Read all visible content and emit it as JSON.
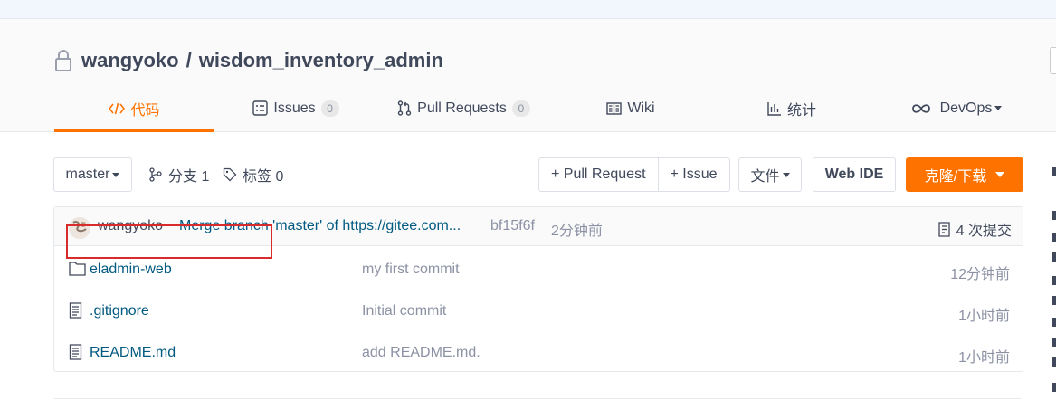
{
  "repo": {
    "owner": "wangyoko",
    "separator": "/",
    "name": "wisdom_inventory_admin"
  },
  "tabs": [
    {
      "label": "代码",
      "icon": "code-icon"
    },
    {
      "label": "Issues",
      "icon": "issues-icon",
      "count": "0"
    },
    {
      "label": "Pull Requests",
      "icon": "pull-request-icon",
      "count": "0"
    },
    {
      "label": "Wiki",
      "icon": "wiki-icon"
    },
    {
      "label": "统计",
      "icon": "stats-icon"
    },
    {
      "label": "DevOps",
      "icon": "infinity-icon"
    }
  ],
  "toolbar": {
    "branch": "master",
    "branches_label": "分支 1",
    "tags_label": "标签 0",
    "pull_request": "+ Pull Request",
    "issue": "+ Issue",
    "file": "文件",
    "web_ide": "Web IDE",
    "clone": "克隆/下载"
  },
  "latest_commit": {
    "author": "wangyoko",
    "message": "Merge branch 'master' of https://gitee.com...",
    "hash": "bf15f6f",
    "time": "2分钟前",
    "count_label": "4 次提交"
  },
  "files": [
    {
      "name": "eladmin-web",
      "type": "folder",
      "message": "my first commit",
      "time": "12分钟前"
    },
    {
      "name": ".gitignore",
      "type": "file",
      "message": "Initial commit",
      "time": "1小时前"
    },
    {
      "name": "README.md",
      "type": "file",
      "message": "add README.md.",
      "time": "1小时前"
    }
  ],
  "colors": {
    "accent": "#fe7300",
    "link": "#005980",
    "muted": "#8c92a4",
    "highlight": "#d82c2c"
  }
}
